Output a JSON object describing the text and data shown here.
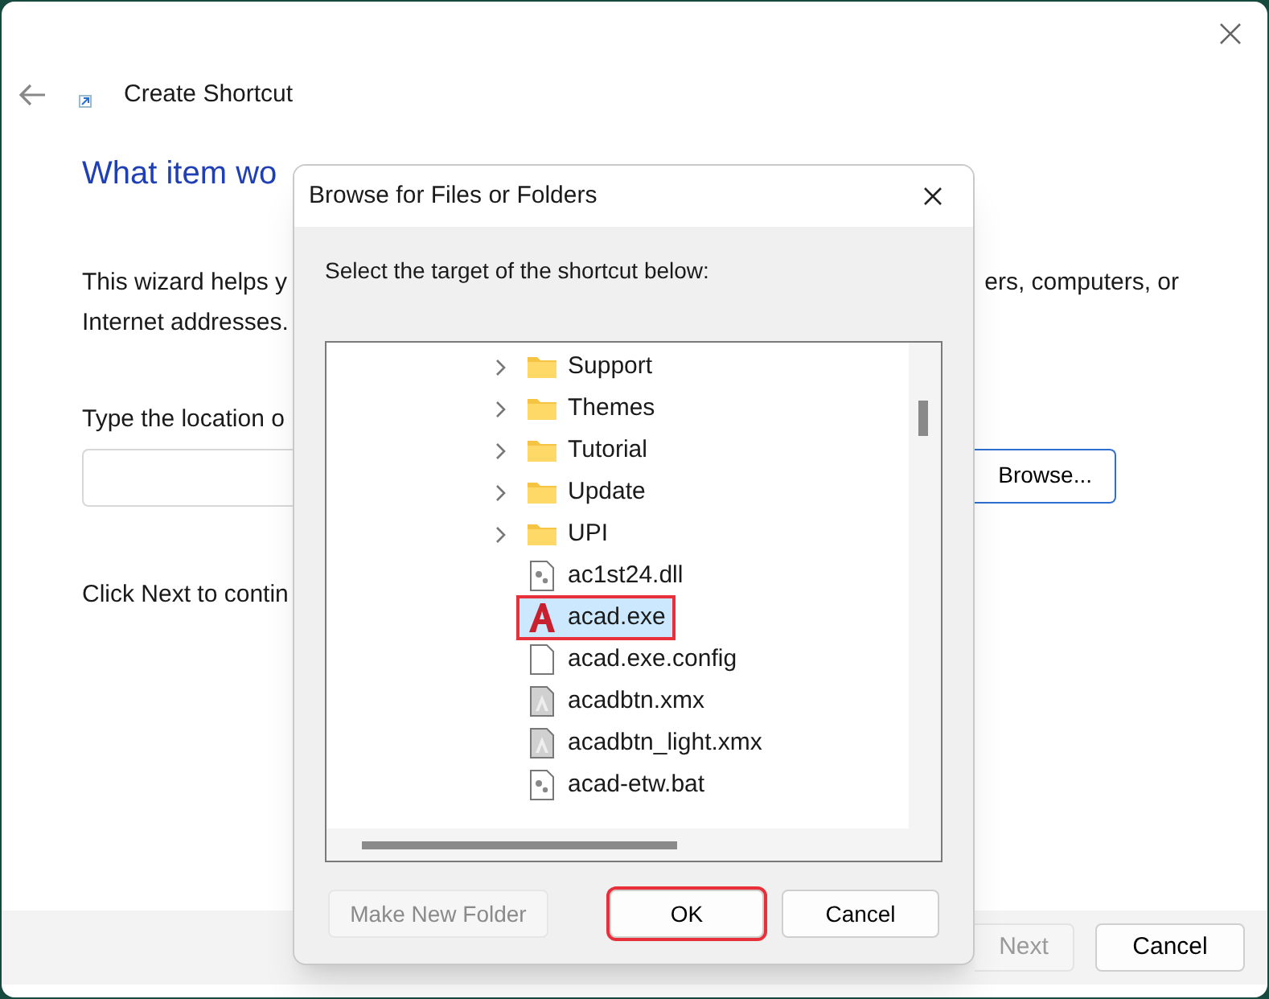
{
  "window": {
    "title": "Create Shortcut"
  },
  "wizard": {
    "heading": "What item wo",
    "intro_left": "This wizard helps y",
    "intro_right": "ers, computers, or",
    "intro_line2": "Internet addresses.",
    "location_label": "Type the location o",
    "browse_button": "Browse...",
    "footer_text": "Click Next to contin"
  },
  "footer_buttons": [
    {
      "label": "Next",
      "disabled": true
    },
    {
      "label": "Cancel",
      "disabled": false
    }
  ],
  "dialog": {
    "title": "Browse for Files or Folders",
    "instruction": "Select the target of the shortcut below:",
    "items": [
      {
        "kind": "folder",
        "label": "Support",
        "selected": false,
        "highlighted": false
      },
      {
        "kind": "folder",
        "label": "Themes",
        "selected": false,
        "highlighted": false
      },
      {
        "kind": "folder",
        "label": "Tutorial",
        "selected": false,
        "highlighted": false
      },
      {
        "kind": "folder",
        "label": "Update",
        "selected": false,
        "highlighted": false
      },
      {
        "kind": "folder",
        "label": "UPI",
        "selected": false,
        "highlighted": false
      },
      {
        "kind": "settings-file",
        "label": "ac1st24.dll",
        "selected": false,
        "highlighted": false
      },
      {
        "kind": "app",
        "label": "acad.exe",
        "selected": true,
        "highlighted": true
      },
      {
        "kind": "file",
        "label": "acad.exe.config",
        "selected": false,
        "highlighted": false
      },
      {
        "kind": "grey-file",
        "label": "acadbtn.xmx",
        "selected": false,
        "highlighted": false
      },
      {
        "kind": "grey-file",
        "label": "acadbtn_light.xmx",
        "selected": false,
        "highlighted": false
      },
      {
        "kind": "script",
        "label": "acad-etw.bat",
        "selected": false,
        "highlighted": false
      }
    ],
    "buttons": [
      {
        "label": "Make New Folder",
        "disabled": true,
        "highlighted": false
      },
      {
        "label": "OK",
        "disabled": false,
        "highlighted": true
      },
      {
        "label": "Cancel",
        "disabled": false,
        "highlighted": false
      }
    ]
  }
}
